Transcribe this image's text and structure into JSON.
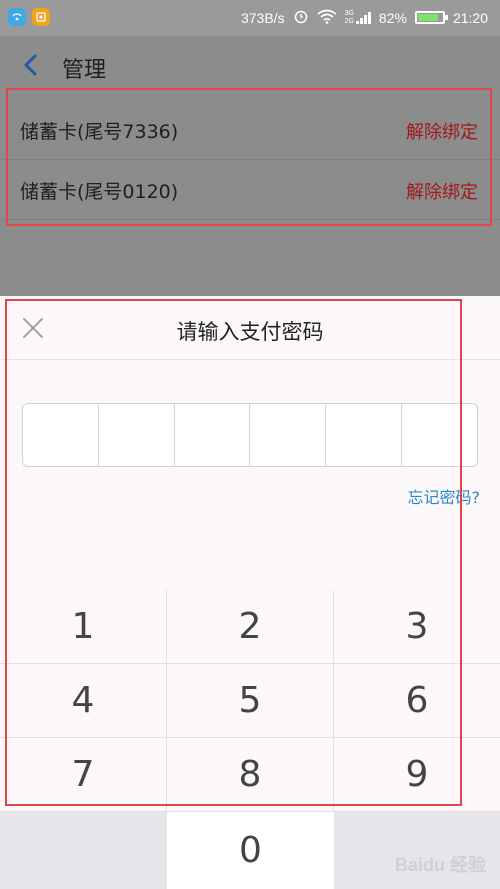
{
  "status_bar": {
    "app_icon_1": "wifi-hotspot-icon",
    "app_icon_2": "app-notification-icon",
    "net_speed": "373B/s",
    "signal_top": "3G",
    "signal_bottom": "2G",
    "battery_percent": "82%",
    "battery_level": 0.82,
    "time": "21:20"
  },
  "nav": {
    "title": "管理"
  },
  "cards": [
    {
      "name": "储蓄卡(尾号7336)",
      "action": "解除绑定"
    },
    {
      "name": "储蓄卡(尾号0120)",
      "action": "解除绑定"
    }
  ],
  "password_sheet": {
    "title": "请输入支付密码",
    "digits_total": 6,
    "forgot": "忘记密码?"
  },
  "keypad": {
    "keys": [
      "1",
      "2",
      "3",
      "4",
      "5",
      "6",
      "7",
      "8",
      "9",
      "",
      "0",
      ""
    ]
  },
  "watermark": "Baidu 经验",
  "colors": {
    "unbind": "#a31818",
    "link": "#2b89c9",
    "highlight_box": "#e24545"
  }
}
